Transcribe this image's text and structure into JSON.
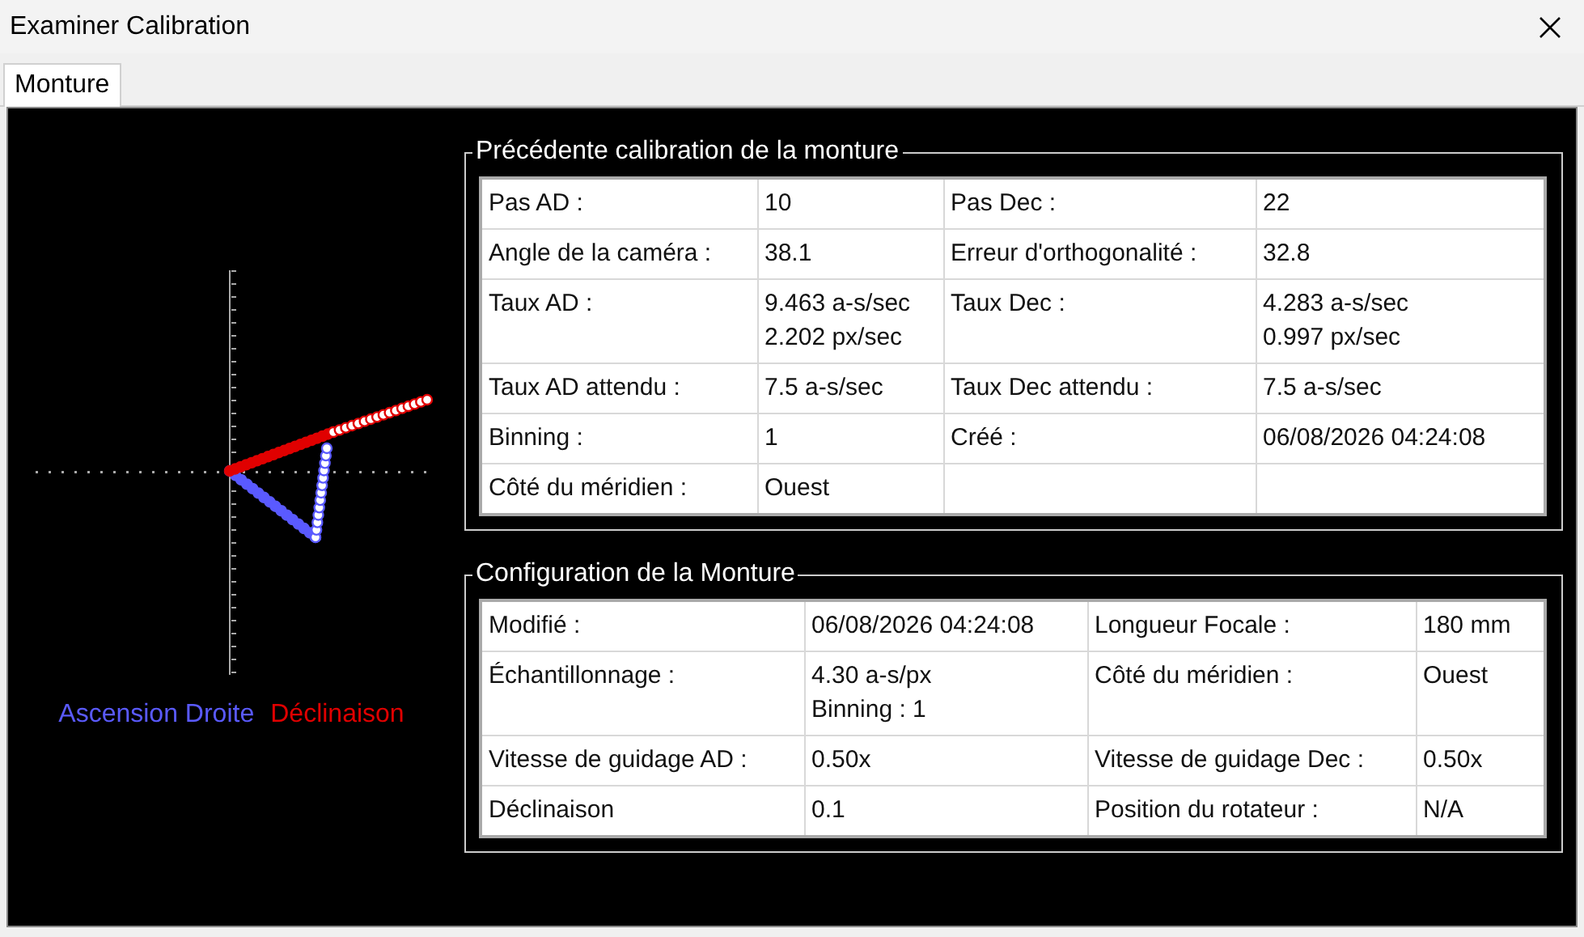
{
  "window": {
    "title": "Examiner Calibration"
  },
  "tabs": [
    {
      "label": "Monture",
      "selected": true
    }
  ],
  "legend": [
    {
      "label": "Ascension Droite",
      "color": "#5a5aff"
    },
    {
      "label": "Déclinaison",
      "color": "#e00000"
    }
  ],
  "groups": [
    {
      "title": "Précédente calibration de la monture",
      "kind": "calibration",
      "rows": [
        [
          "Pas AD :",
          "10",
          "Pas Dec :",
          "22"
        ],
        [
          "Angle de la caméra :",
          "38.1",
          "Erreur d'orthogonalité :",
          "32.8"
        ],
        [
          "Taux AD :",
          "9.463 a-s/sec\n2.202 px/sec",
          "Taux Dec :",
          "4.283 a-s/sec\n0.997 px/sec"
        ],
        [
          "Taux AD attendu :",
          "7.5 a-s/sec",
          "Taux Dec attendu :",
          "7.5 a-s/sec"
        ],
        [
          "Binning :",
          "1",
          "Créé :",
          "06/08/2026 04:24:08"
        ],
        [
          "Côté du méridien :",
          "Ouest",
          "",
          ""
        ]
      ]
    },
    {
      "title": "Configuration de la Monture",
      "kind": "config",
      "rows": [
        [
          "Modifié :",
          "06/08/2026 04:24:08",
          "Longueur Focale :",
          "180 mm"
        ],
        [
          "Échantillonnage :",
          "4.30 a-s/px\nBinning : 1",
          "Côté du méridien :",
          "Ouest"
        ],
        [
          "Vitesse de guidage AD :",
          "0.50x",
          "Vitesse de guidage Dec :",
          "0.50x"
        ],
        [
          "Déclinaison",
          "0.1",
          "Position du rotateur :",
          "N/A"
        ]
      ]
    }
  ]
}
